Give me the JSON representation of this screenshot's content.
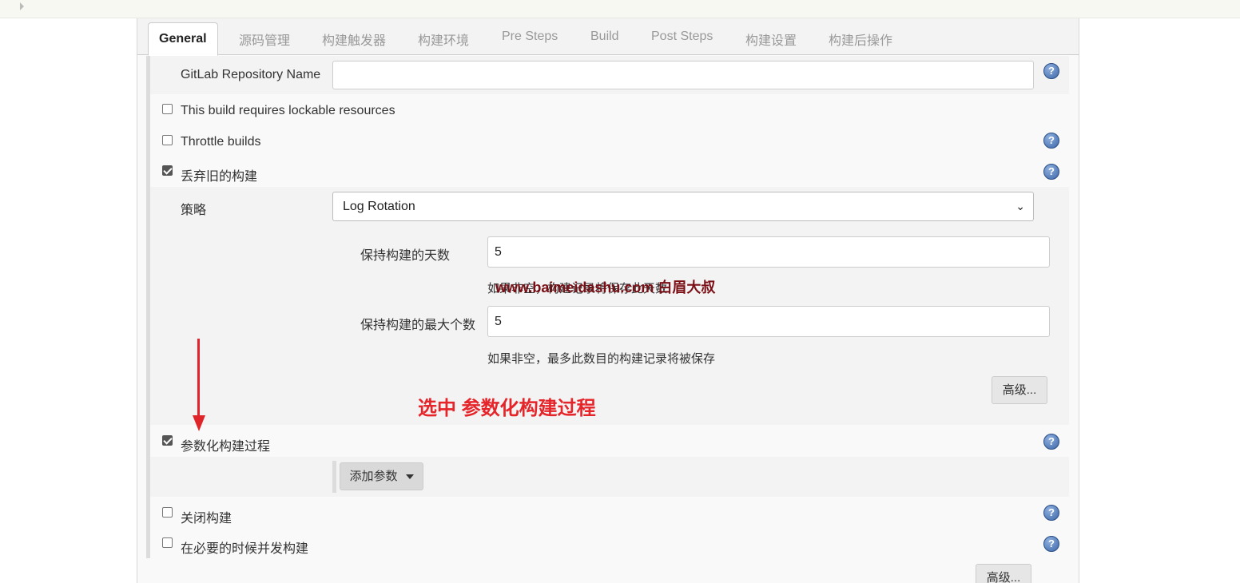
{
  "tabs": [
    "General",
    "源码管理",
    "构建触发器",
    "构建环境",
    "Pre Steps",
    "Build",
    "Post Steps",
    "构建设置",
    "构建后操作"
  ],
  "gitlab": {
    "label": "GitLab Repository Name",
    "value": ""
  },
  "options": {
    "lockable": {
      "label": "This build requires lockable resources",
      "checked": false
    },
    "throttle": {
      "label": "Throttle builds",
      "checked": false
    },
    "discard_old": {
      "label": "丢弃旧的构建",
      "checked": true
    },
    "parameterized": {
      "label": "参数化构建过程",
      "checked": true
    },
    "disable": {
      "label": "关闭构建",
      "checked": false
    },
    "concurrent": {
      "label": "在必要的时候并发构建",
      "checked": false
    }
  },
  "strategy": {
    "label": "策略",
    "selected": "Log Rotation"
  },
  "days_to_keep": {
    "label": "保持构建的天数",
    "value": "5",
    "hint": "如果非空，构建记录将保存此天数"
  },
  "num_to_keep": {
    "label": "保持构建的最大个数",
    "value": "5",
    "hint": "如果非空，最多此数目的构建记录将被保存"
  },
  "advanced_label": "高级...",
  "add_param_label": "添加参数",
  "help_glyph": "?",
  "watermark": "www.baimeidashu.com 白眉大叔",
  "annotation": "选中 参数化构建过程",
  "colors": {
    "annotation": "#e5252a",
    "watermark": "#7a0f16",
    "help_icon": "#3d67a8"
  }
}
